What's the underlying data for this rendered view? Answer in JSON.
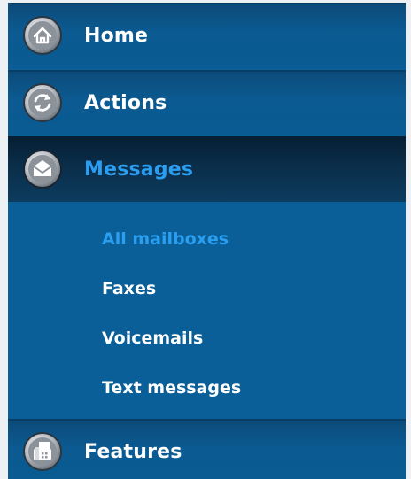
{
  "nav": {
    "items": [
      {
        "label": "Home",
        "icon": "home-icon"
      },
      {
        "label": "Actions",
        "icon": "refresh-icon"
      },
      {
        "label": "Messages",
        "icon": "envelope-icon"
      },
      {
        "label": "Features",
        "icon": "fax-icon"
      }
    ],
    "active_index": 2,
    "messages_submenu": [
      {
        "label": "All mailboxes",
        "selected": true
      },
      {
        "label": "Faxes",
        "selected": false
      },
      {
        "label": "Voicemails",
        "selected": false
      },
      {
        "label": "Text messages",
        "selected": false
      }
    ]
  },
  "colors": {
    "nav_background": "#0a5f98",
    "active_text": "#2a9ef0",
    "text": "#ffffff"
  }
}
